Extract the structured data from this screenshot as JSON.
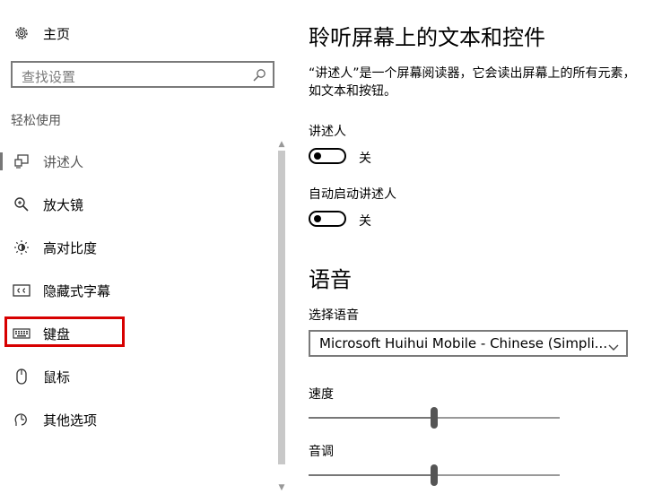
{
  "sidebar": {
    "home_label": "主页",
    "search_placeholder": "查找设置",
    "section_title": "轻松使用",
    "items": [
      {
        "label": "讲述人",
        "icon": "narrator-icon",
        "active": true
      },
      {
        "label": "放大镜",
        "icon": "magnifier-icon"
      },
      {
        "label": "高对比度",
        "icon": "high-contrast-icon"
      },
      {
        "label": "隐藏式字幕",
        "icon": "closed-captions-icon"
      },
      {
        "label": "键盘",
        "icon": "keyboard-icon",
        "highlighted": true
      },
      {
        "label": "鼠标",
        "icon": "mouse-icon"
      },
      {
        "label": "其他选项",
        "icon": "other-options-icon"
      }
    ]
  },
  "main": {
    "title": "聆听屏幕上的文本和控件",
    "description": "“讲述人”是一个屏幕阅读器，它会读出屏幕上的所有元素，如文本和按钮。",
    "narrator": {
      "label": "讲述人",
      "state": "关",
      "on": false
    },
    "auto_start": {
      "label": "自动启动讲述人",
      "state": "关",
      "on": false
    },
    "voice_heading": "语音",
    "choose_voice_label": "选择语音",
    "voice_selected": "Microsoft Huihui Mobile - Chinese (Simpli...",
    "speed": {
      "label": "速度",
      "value": 0.5
    },
    "pitch": {
      "label": "音调",
      "value": 0.5
    }
  },
  "colors": {
    "highlight": "#d70000",
    "accent": "#000000"
  }
}
